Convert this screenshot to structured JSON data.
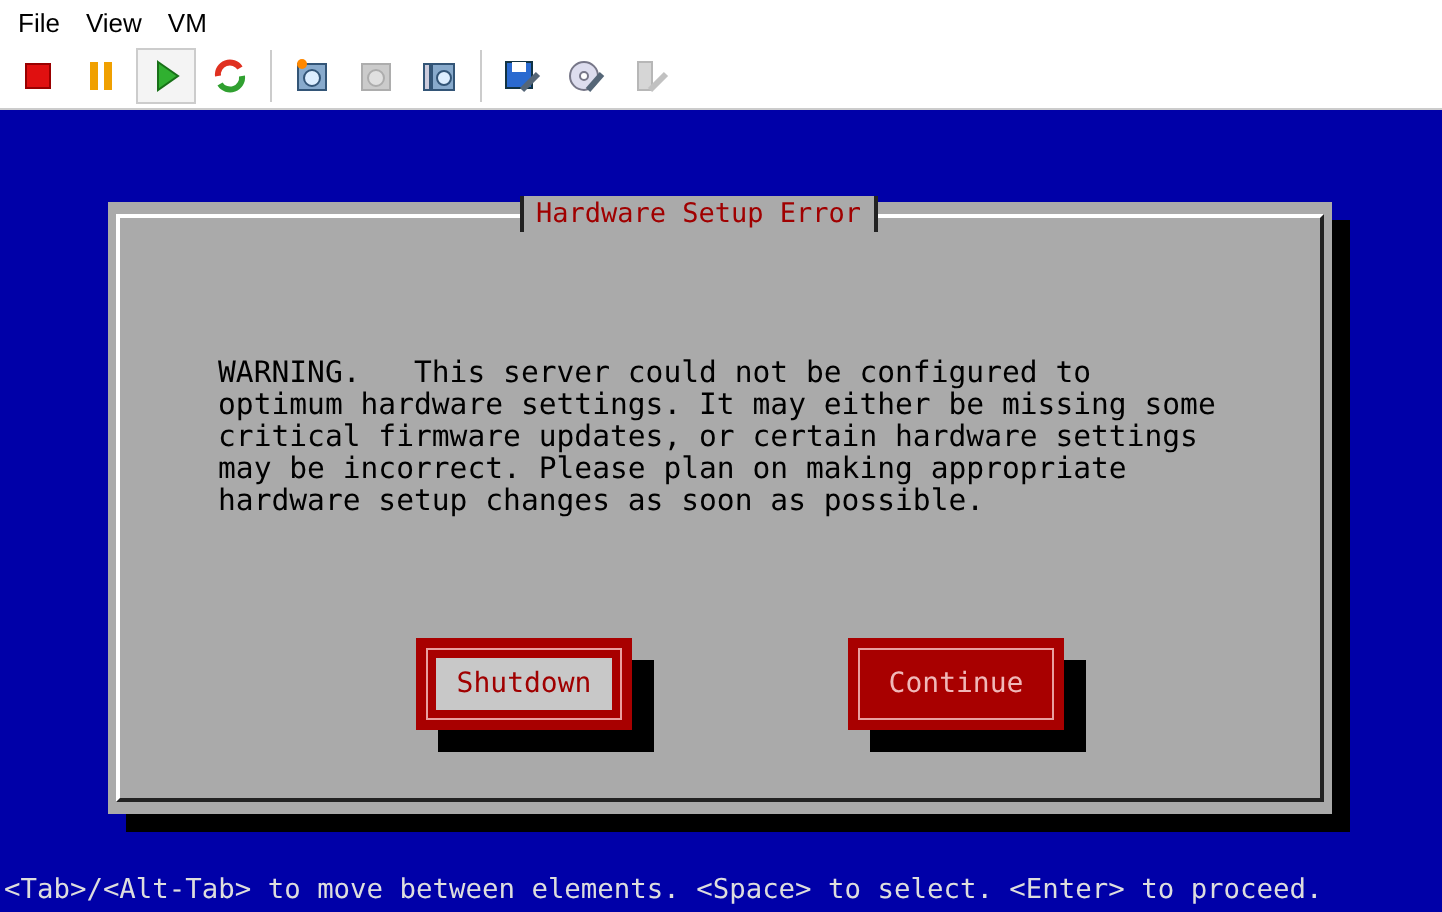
{
  "menu": [
    "File",
    "View",
    "VM"
  ],
  "toolbar": [
    {
      "kind": "stop",
      "disabled": false,
      "pressed": false
    },
    {
      "kind": "pause",
      "disabled": false,
      "pressed": false
    },
    {
      "kind": "play",
      "disabled": false,
      "pressed": true
    },
    {
      "kind": "reset",
      "disabled": false,
      "pressed": false
    },
    {
      "kind": "separator"
    },
    {
      "kind": "snapshot",
      "disabled": false,
      "pressed": false
    },
    {
      "kind": "revert",
      "disabled": true,
      "pressed": false
    },
    {
      "kind": "manager",
      "disabled": false,
      "pressed": false
    },
    {
      "kind": "separator"
    },
    {
      "kind": "settings",
      "disabled": false,
      "pressed": false
    },
    {
      "kind": "disc",
      "disabled": false,
      "pressed": false
    },
    {
      "kind": "usb",
      "disabled": true,
      "pressed": false
    }
  ],
  "dialog": {
    "title": "Hardware Setup Error",
    "message": [
      "WARNING.   This server could not be configured to",
      "optimum hardware settings. It may either be missing some",
      "critical firmware updates, or certain hardware settings",
      "may be incorrect. Please plan on making appropriate",
      "hardware setup changes as soon as possible."
    ],
    "buttons": [
      {
        "label": "Shutdown",
        "selected": true
      },
      {
        "label": "Continue",
        "selected": false
      }
    ]
  },
  "status_bar": "<Tab>/<Alt-Tab> to move between elements. <Space> to select. <Enter> to proceed."
}
